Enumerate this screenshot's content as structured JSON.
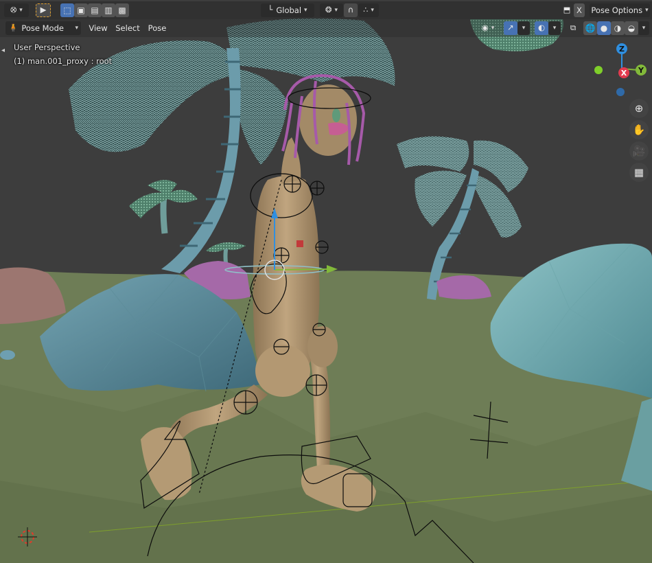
{
  "header": {
    "editor_type_icon": "3d-viewport-icon",
    "transform_orientation": "Global",
    "pose_options_label": "Pose Options",
    "x_mirror_label": "X",
    "mode_label": "Pose Mode",
    "menus": [
      "View",
      "Select",
      "Pose"
    ]
  },
  "overlay": {
    "perspective_label": "User Perspective",
    "object_label": "(1) man.001_proxy : root"
  },
  "gizmo": {
    "axis_z": "Z",
    "axis_y": "Y",
    "axis_x": "X"
  },
  "navigation": [
    "zoom-icon",
    "hand-pan-icon",
    "camera-icon",
    "grid-ortho-icon"
  ],
  "colors": {
    "accent": "#4772b3",
    "axis_x": "#e23a4e",
    "axis_y": "#82b93a",
    "axis_z": "#2f8fe0",
    "ground": "#6a7a52",
    "sky": "#3d3d3d"
  }
}
